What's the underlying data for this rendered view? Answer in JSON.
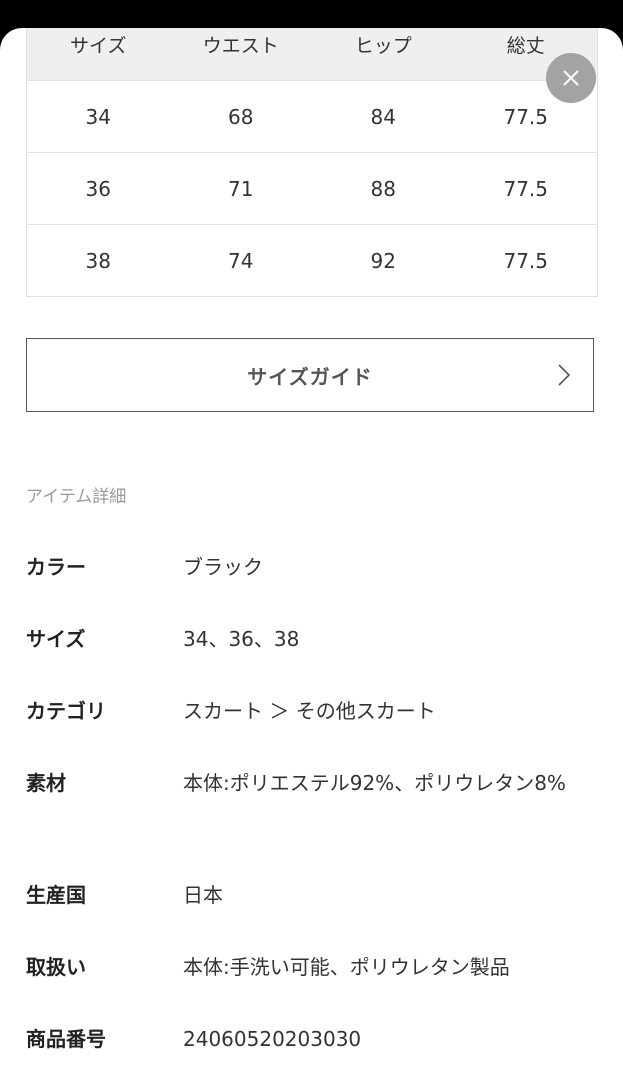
{
  "size_table": {
    "headers": [
      "サイズ",
      "ウエスト",
      "ヒップ",
      "総丈"
    ],
    "rows": [
      [
        "34",
        "68",
        "84",
        "77.5"
      ],
      [
        "36",
        "71",
        "88",
        "77.5"
      ],
      [
        "38",
        "74",
        "92",
        "77.5"
      ]
    ]
  },
  "size_guide": {
    "label": "サイズガイド"
  },
  "item_details": {
    "title": "アイテム詳細",
    "color": {
      "label": "カラー",
      "value": "ブラック"
    },
    "size": {
      "label": "サイズ",
      "value": "34、36、38"
    },
    "category": {
      "label": "カテゴリ",
      "value": "スカート ＞ その他スカート"
    },
    "material": {
      "label": "素材",
      "value": "本体:ポリエステル92%、ポリウレタン8%"
    },
    "origin": {
      "label": "生産国",
      "value": "日本"
    },
    "care": {
      "label": "取扱い",
      "value": "本体:手洗い可能、ポリウレタン製品"
    },
    "product_number": {
      "label": "商品番号",
      "value": "24060520203030"
    }
  },
  "icons": {
    "close": "close-icon",
    "chevron": "chevron-right-icon"
  },
  "colors": {
    "header_bg": "#efefef",
    "close_bg": "#a3a3a3",
    "border": "#555555"
  }
}
